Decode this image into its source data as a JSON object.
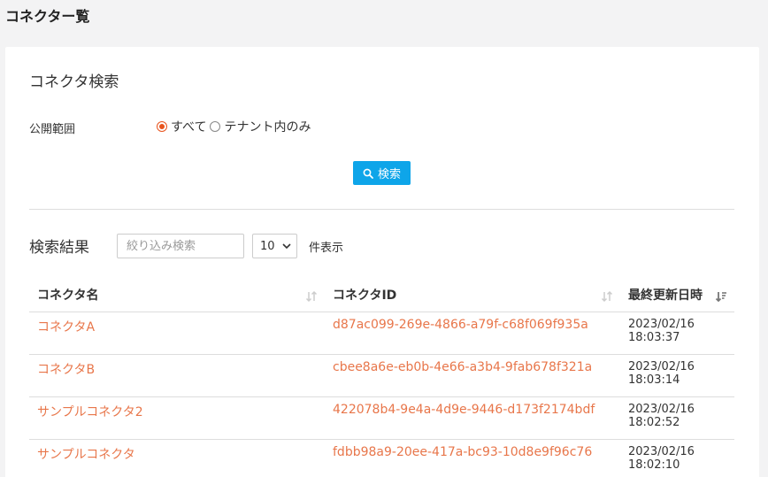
{
  "page": {
    "title": "コネクター覧"
  },
  "search": {
    "title": "コネクタ検索",
    "scope_label": "公開範囲",
    "options": [
      {
        "label": "すべて",
        "checked": true
      },
      {
        "label": "テナント内のみ",
        "checked": false
      }
    ],
    "button_label": "検索"
  },
  "results": {
    "title": "検索結果",
    "filter_placeholder": "絞り込み検索",
    "page_size": "10",
    "page_size_suffix": "件表示",
    "columns": [
      "コネクタ名",
      "コネクタID",
      "最終更新日時"
    ],
    "rows": [
      {
        "name": "コネクタA",
        "id": "d87ac099-269e-4866-a79f-c68f069f935a",
        "date": "2023/02/16",
        "time": "18:03:37"
      },
      {
        "name": "コネクタB",
        "id": "cbee8a6e-eb0b-4e66-a3b4-9fab678f321a",
        "date": "2023/02/16",
        "time": "18:03:14"
      },
      {
        "name": "サンプルコネクタ2",
        "id": "422078b4-9e4a-4d9e-9446-d173f2174bdf",
        "date": "2023/02/16",
        "time": "18:02:52"
      },
      {
        "name": "サンプルコネクタ",
        "id": "fdbb98a9-20ee-417a-bc93-10d8e9f96c76",
        "date": "2023/02/16",
        "time": "18:02:10"
      }
    ]
  },
  "colors": {
    "accent": "#0ea5e9",
    "link": "#e8764a",
    "radio": "#e8541e"
  }
}
